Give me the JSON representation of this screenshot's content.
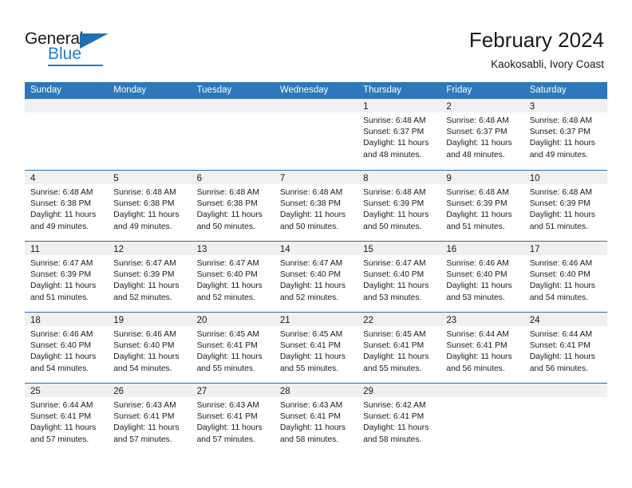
{
  "logo": {
    "word1": "General",
    "word2": "Blue",
    "triangle_color": "#1f6fb4",
    "blue_color": "#1f7fd0"
  },
  "header": {
    "title": "February 2024",
    "subtitle": "Kaokosabli, Ivory Coast"
  },
  "theme": {
    "header_row_bg": "#2e77bb",
    "row_divider": "#2e6ca8",
    "daynum_band_bg": "#f0f0f0"
  },
  "calendar": {
    "weekday_headers": [
      "Sunday",
      "Monday",
      "Tuesday",
      "Wednesday",
      "Thursday",
      "Friday",
      "Saturday"
    ],
    "weeks": [
      [
        {
          "day": "",
          "lines": []
        },
        {
          "day": "",
          "lines": []
        },
        {
          "day": "",
          "lines": []
        },
        {
          "day": "",
          "lines": []
        },
        {
          "day": "1",
          "lines": [
            "Sunrise: 6:48 AM",
            "Sunset: 6:37 PM",
            "Daylight: 11 hours",
            "and 48 minutes."
          ]
        },
        {
          "day": "2",
          "lines": [
            "Sunrise: 6:48 AM",
            "Sunset: 6:37 PM",
            "Daylight: 11 hours",
            "and 48 minutes."
          ]
        },
        {
          "day": "3",
          "lines": [
            "Sunrise: 6:48 AM",
            "Sunset: 6:37 PM",
            "Daylight: 11 hours",
            "and 49 minutes."
          ]
        }
      ],
      [
        {
          "day": "4",
          "lines": [
            "Sunrise: 6:48 AM",
            "Sunset: 6:38 PM",
            "Daylight: 11 hours",
            "and 49 minutes."
          ]
        },
        {
          "day": "5",
          "lines": [
            "Sunrise: 6:48 AM",
            "Sunset: 6:38 PM",
            "Daylight: 11 hours",
            "and 49 minutes."
          ]
        },
        {
          "day": "6",
          "lines": [
            "Sunrise: 6:48 AM",
            "Sunset: 6:38 PM",
            "Daylight: 11 hours",
            "and 50 minutes."
          ]
        },
        {
          "day": "7",
          "lines": [
            "Sunrise: 6:48 AM",
            "Sunset: 6:38 PM",
            "Daylight: 11 hours",
            "and 50 minutes."
          ]
        },
        {
          "day": "8",
          "lines": [
            "Sunrise: 6:48 AM",
            "Sunset: 6:39 PM",
            "Daylight: 11 hours",
            "and 50 minutes."
          ]
        },
        {
          "day": "9",
          "lines": [
            "Sunrise: 6:48 AM",
            "Sunset: 6:39 PM",
            "Daylight: 11 hours",
            "and 51 minutes."
          ]
        },
        {
          "day": "10",
          "lines": [
            "Sunrise: 6:48 AM",
            "Sunset: 6:39 PM",
            "Daylight: 11 hours",
            "and 51 minutes."
          ]
        }
      ],
      [
        {
          "day": "11",
          "lines": [
            "Sunrise: 6:47 AM",
            "Sunset: 6:39 PM",
            "Daylight: 11 hours",
            "and 51 minutes."
          ]
        },
        {
          "day": "12",
          "lines": [
            "Sunrise: 6:47 AM",
            "Sunset: 6:39 PM",
            "Daylight: 11 hours",
            "and 52 minutes."
          ]
        },
        {
          "day": "13",
          "lines": [
            "Sunrise: 6:47 AM",
            "Sunset: 6:40 PM",
            "Daylight: 11 hours",
            "and 52 minutes."
          ]
        },
        {
          "day": "14",
          "lines": [
            "Sunrise: 6:47 AM",
            "Sunset: 6:40 PM",
            "Daylight: 11 hours",
            "and 52 minutes."
          ]
        },
        {
          "day": "15",
          "lines": [
            "Sunrise: 6:47 AM",
            "Sunset: 6:40 PM",
            "Daylight: 11 hours",
            "and 53 minutes."
          ]
        },
        {
          "day": "16",
          "lines": [
            "Sunrise: 6:46 AM",
            "Sunset: 6:40 PM",
            "Daylight: 11 hours",
            "and 53 minutes."
          ]
        },
        {
          "day": "17",
          "lines": [
            "Sunrise: 6:46 AM",
            "Sunset: 6:40 PM",
            "Daylight: 11 hours",
            "and 54 minutes."
          ]
        }
      ],
      [
        {
          "day": "18",
          "lines": [
            "Sunrise: 6:46 AM",
            "Sunset: 6:40 PM",
            "Daylight: 11 hours",
            "and 54 minutes."
          ]
        },
        {
          "day": "19",
          "lines": [
            "Sunrise: 6:46 AM",
            "Sunset: 6:40 PM",
            "Daylight: 11 hours",
            "and 54 minutes."
          ]
        },
        {
          "day": "20",
          "lines": [
            "Sunrise: 6:45 AM",
            "Sunset: 6:41 PM",
            "Daylight: 11 hours",
            "and 55 minutes."
          ]
        },
        {
          "day": "21",
          "lines": [
            "Sunrise: 6:45 AM",
            "Sunset: 6:41 PM",
            "Daylight: 11 hours",
            "and 55 minutes."
          ]
        },
        {
          "day": "22",
          "lines": [
            "Sunrise: 6:45 AM",
            "Sunset: 6:41 PM",
            "Daylight: 11 hours",
            "and 55 minutes."
          ]
        },
        {
          "day": "23",
          "lines": [
            "Sunrise: 6:44 AM",
            "Sunset: 6:41 PM",
            "Daylight: 11 hours",
            "and 56 minutes."
          ]
        },
        {
          "day": "24",
          "lines": [
            "Sunrise: 6:44 AM",
            "Sunset: 6:41 PM",
            "Daylight: 11 hours",
            "and 56 minutes."
          ]
        }
      ],
      [
        {
          "day": "25",
          "lines": [
            "Sunrise: 6:44 AM",
            "Sunset: 6:41 PM",
            "Daylight: 11 hours",
            "and 57 minutes."
          ]
        },
        {
          "day": "26",
          "lines": [
            "Sunrise: 6:43 AM",
            "Sunset: 6:41 PM",
            "Daylight: 11 hours",
            "and 57 minutes."
          ]
        },
        {
          "day": "27",
          "lines": [
            "Sunrise: 6:43 AM",
            "Sunset: 6:41 PM",
            "Daylight: 11 hours",
            "and 57 minutes."
          ]
        },
        {
          "day": "28",
          "lines": [
            "Sunrise: 6:43 AM",
            "Sunset: 6:41 PM",
            "Daylight: 11 hours",
            "and 58 minutes."
          ]
        },
        {
          "day": "29",
          "lines": [
            "Sunrise: 6:42 AM",
            "Sunset: 6:41 PM",
            "Daylight: 11 hours",
            "and 58 minutes."
          ]
        },
        {
          "day": "",
          "lines": []
        },
        {
          "day": "",
          "lines": []
        }
      ]
    ]
  }
}
